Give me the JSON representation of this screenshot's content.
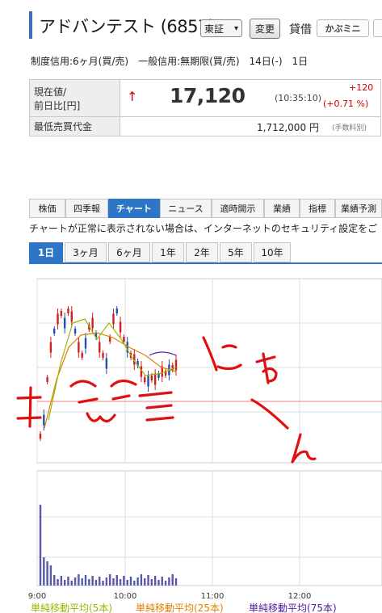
{
  "header": {
    "title": "アドバンテスト (6857)",
    "market": "東証",
    "change_button": "変更",
    "lending_label": "貸借",
    "kabumini_label": "かぶミニ"
  },
  "credit_line": "制度信用:6ヶ月(買/売)　一般信用:無期限(買/売)　14日(-)　1日",
  "price": {
    "label_line1": "現在値/",
    "label_line2": "前日比[円]",
    "arrow": "↑",
    "value": "17,120",
    "time": "(10:35:10)",
    "change": "+120",
    "change_pct": "(+0.71 %)",
    "min_label": "最低売買代金",
    "min_value": "1,712,000 円",
    "min_note": "(手数料別)"
  },
  "tabs": [
    "株価",
    "四季報",
    "チャート",
    "ニュース",
    "適時開示",
    "業績",
    "指標",
    "業績予測"
  ],
  "active_tab": "チャート",
  "notice": "チャートが正常に表示されない場合は、インターネットのセキュリティ設定をご",
  "ranges": [
    "1日",
    "3ヶ月",
    "6ヶ月",
    "1年",
    "2年",
    "5年",
    "10年"
  ],
  "active_range": "1日",
  "chart_data": {
    "type": "line",
    "x": [
      "9:00",
      "10:00",
      "11:00",
      "12:00"
    ],
    "legend": [
      {
        "name": "単純移動平均(5本)",
        "color": "#9ab800"
      },
      {
        "name": "単純移動平均(25本)",
        "color": "#e08000"
      },
      {
        "name": "単純移動平均(75本)",
        "color": "#5020a0"
      }
    ],
    "colors": {
      "up": "#d02020",
      "down": "#2050b0",
      "volume": "#5858a8",
      "grid": "#dddddd"
    }
  },
  "drawing_text": "にゃーん"
}
